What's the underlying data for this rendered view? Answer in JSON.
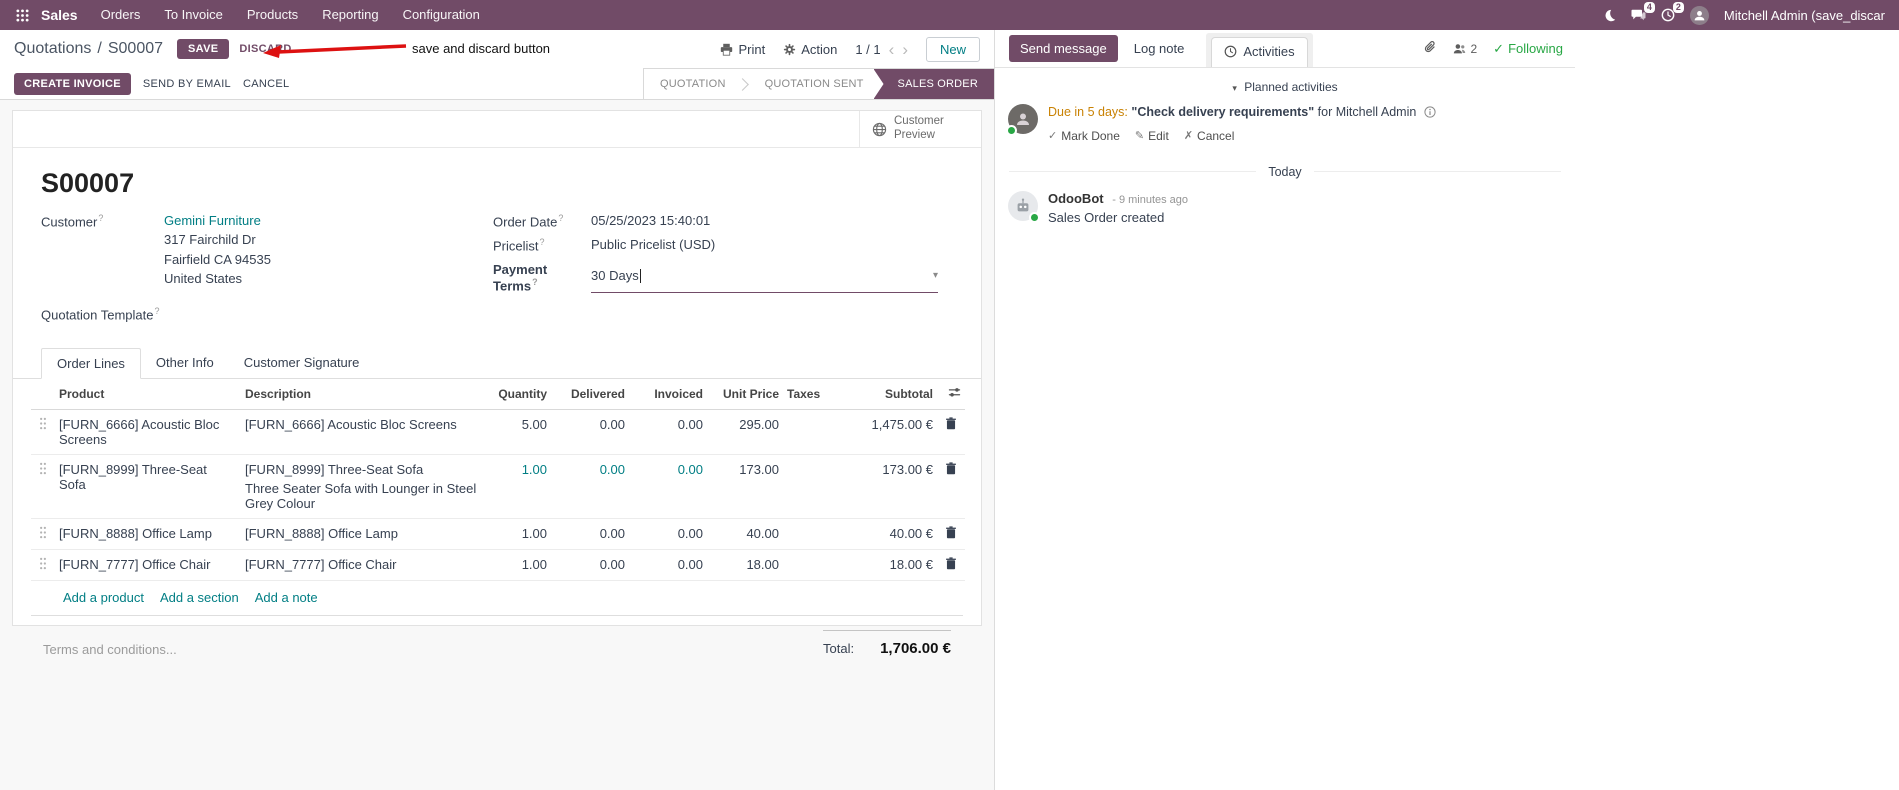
{
  "help_marker": "?",
  "navbar": {
    "app_name": "Sales",
    "menus": [
      {
        "label": "Orders"
      },
      {
        "label": "To Invoice"
      },
      {
        "label": "Products"
      },
      {
        "label": "Reporting"
      },
      {
        "label": "Configuration"
      }
    ],
    "messages_badge": "4",
    "activities_badge": "2",
    "user_name": "Mitchell Admin (save_discar"
  },
  "control_panel": {
    "breadcrumb_parent": "Quotations",
    "breadcrumb_sep": "/",
    "breadcrumb_current": "S00007",
    "save": "SAVE",
    "discard": "DISCARD",
    "annotation": "save and discard button",
    "print": "Print",
    "action": "Action",
    "pager": "1 / 1",
    "prev": "‹",
    "next": "›",
    "new": "New"
  },
  "statusbar": {
    "create_invoice": "CREATE INVOICE",
    "send_by_email": "SEND BY EMAIL",
    "cancel": "CANCEL",
    "states": [
      {
        "label": "QUOTATION"
      },
      {
        "label": "QUOTATION SENT"
      },
      {
        "label": "SALES ORDER"
      }
    ]
  },
  "sheet": {
    "customer_preview": "Customer Preview",
    "title": "S00007",
    "customer_label": "Customer",
    "customer_name": "Gemini Furniture",
    "address_line1": "317 Fairchild Dr",
    "address_line2": "Fairfield CA 94535",
    "address_line3": "United States",
    "quotation_template_label": "Quotation Template",
    "order_date_label": "Order Date",
    "order_date": "05/25/2023 15:40:01",
    "pricelist_label": "Pricelist",
    "pricelist": "Public Pricelist (USD)",
    "payment_terms_label": "Payment Terms",
    "payment_terms": "30 Days",
    "dropdown_caret": "▾",
    "tabs": [
      {
        "label": "Order Lines"
      },
      {
        "label": "Other Info"
      },
      {
        "label": "Customer Signature"
      }
    ],
    "columns": {
      "product": "Product",
      "description": "Description",
      "quantity": "Quantity",
      "delivered": "Delivered",
      "invoiced": "Invoiced",
      "unit_price": "Unit Price",
      "taxes": "Taxes",
      "subtotal": "Subtotal"
    },
    "rows": [
      {
        "product": "[FURN_6666] Acoustic Bloc Screens",
        "description": "[FURN_6666] Acoustic Bloc Screens",
        "quantity": "5.00",
        "delivered": "0.00",
        "invoiced": "0.00",
        "unit_price": "295.00",
        "subtotal": "1,475.00 €"
      },
      {
        "product": "[FURN_8999] Three-Seat Sofa",
        "description": "[FURN_8999] Three-Seat Sofa",
        "description2": "Three Seater Sofa with Lounger in Steel Grey Colour",
        "quantity": "1.00",
        "delivered": "0.00",
        "invoiced": "0.00",
        "unit_price": "173.00",
        "subtotal": "173.00 €"
      },
      {
        "product": "[FURN_8888] Office Lamp",
        "description": "[FURN_8888] Office Lamp",
        "quantity": "1.00",
        "delivered": "0.00",
        "invoiced": "0.00",
        "unit_price": "40.00",
        "subtotal": "40.00 €"
      },
      {
        "product": "[FURN_7777] Office Chair",
        "description": "[FURN_7777] Office Chair",
        "quantity": "1.00",
        "delivered": "0.00",
        "invoiced": "0.00",
        "unit_price": "18.00",
        "subtotal": "18.00 €"
      }
    ],
    "add_product": "Add a product",
    "add_section": "Add a section",
    "add_note": "Add a note",
    "terms_placeholder": "Terms and conditions...",
    "total_label": "Total:",
    "total_value": "1,706.00 €"
  },
  "chatter": {
    "send_message": "Send message",
    "log_note": "Log note",
    "activities_tab": "Activities",
    "followers_count": "2",
    "following": "Following",
    "following_check": "✓",
    "planned_triangle": "▾",
    "planned_activities": "Planned activities",
    "activity_due": "Due in 5 days:",
    "activity_summary": "\"Check delivery requirements\"",
    "activity_for": "for Mitchell Admin",
    "mark_done_icon": "✓",
    "mark_done": "Mark Done",
    "edit_icon": "✎",
    "edit": "Edit",
    "cancel_icon": "✗",
    "cancel": "Cancel",
    "date_divider": "Today",
    "msg_author": "OdooBot",
    "msg_time": "- 9 minutes ago",
    "msg_body": "Sales Order created"
  },
  "colors": {
    "primary": "#714B67",
    "accent": "#017e84",
    "arrow_red": "#dd1111"
  }
}
